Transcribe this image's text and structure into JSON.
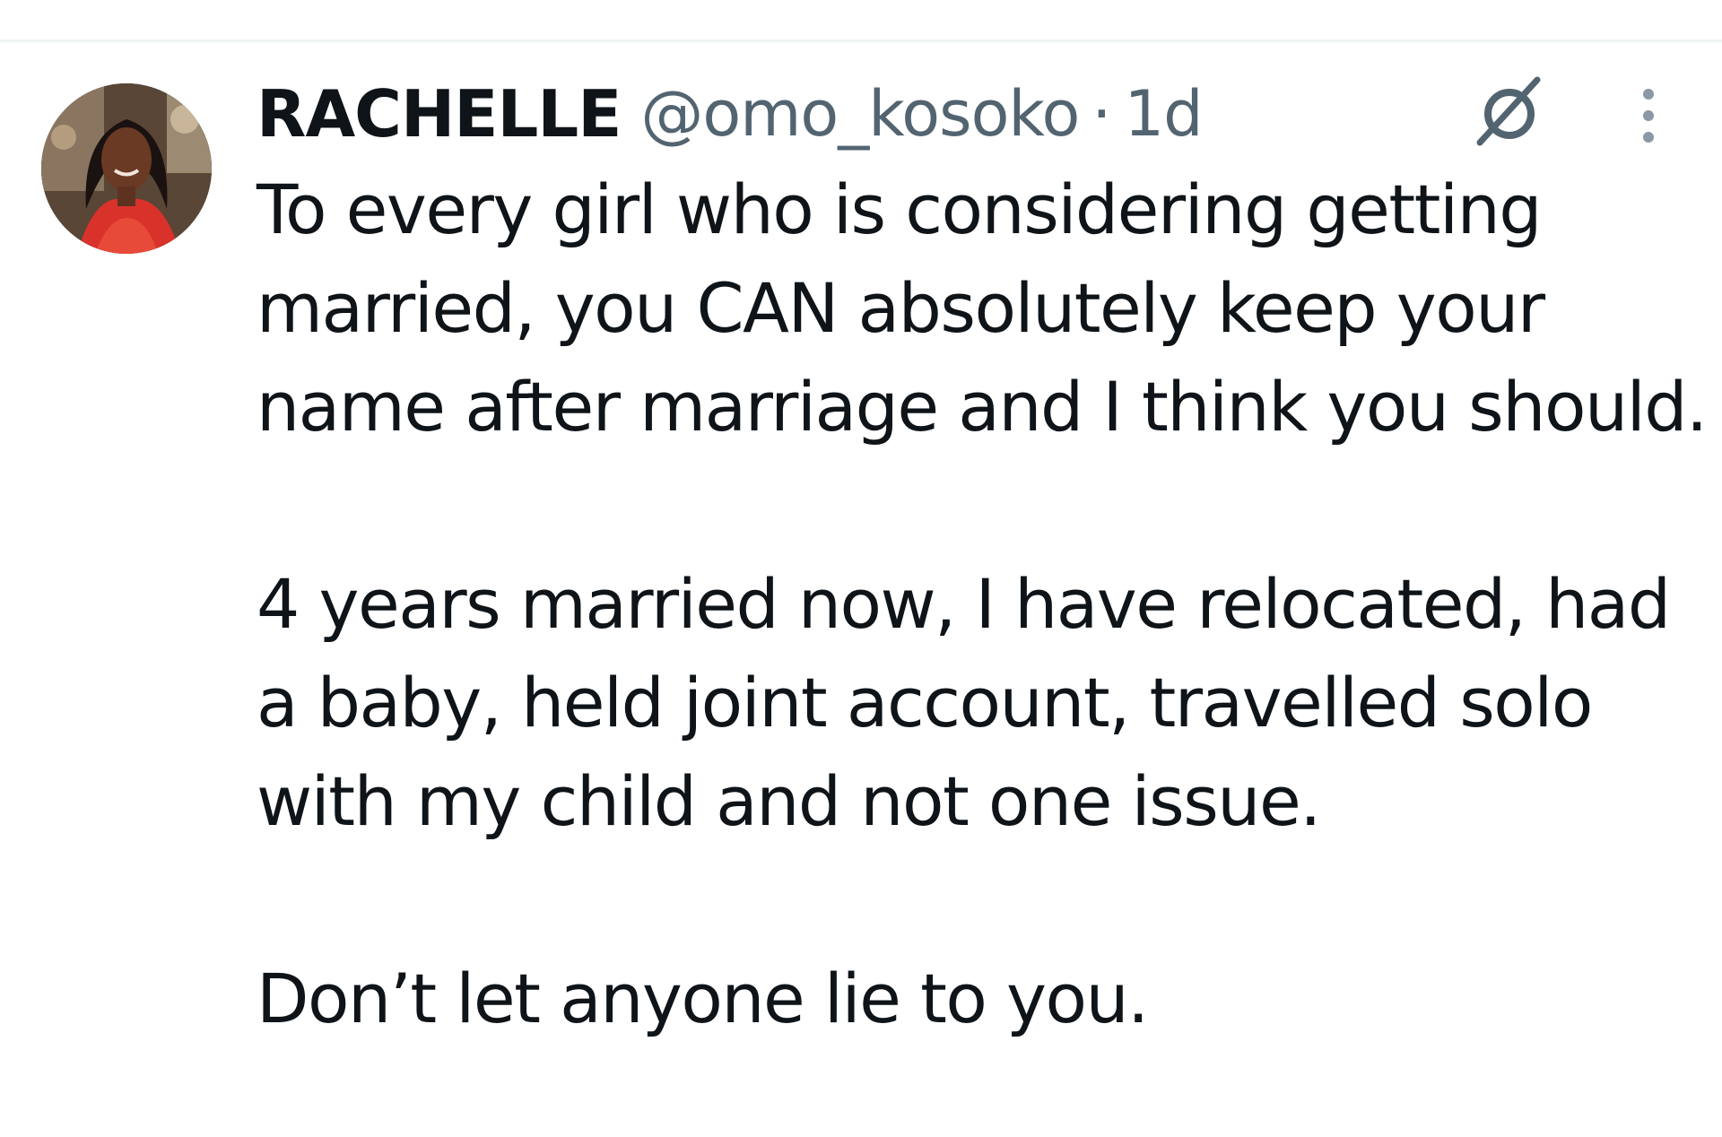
{
  "tweet": {
    "display_name": "RACHELLE",
    "handle": "@omo_kosoko",
    "separator": "·",
    "time": "1d",
    "paragraphs": [
      "To every girl who is considering getting married, you CAN absolutely keep your name after marriage and I think you should.",
      "4 years married now, I have relocated, had a baby, held joint account, travelled solo with my child and not one issue.",
      "Don’t let anyone lie to you."
    ]
  },
  "icons": {
    "grok": "grok-icon",
    "more": "more-options-icon"
  },
  "colors": {
    "primary_text": "#0f1419",
    "secondary_text": "#536471",
    "divider": "#eff3f4"
  }
}
